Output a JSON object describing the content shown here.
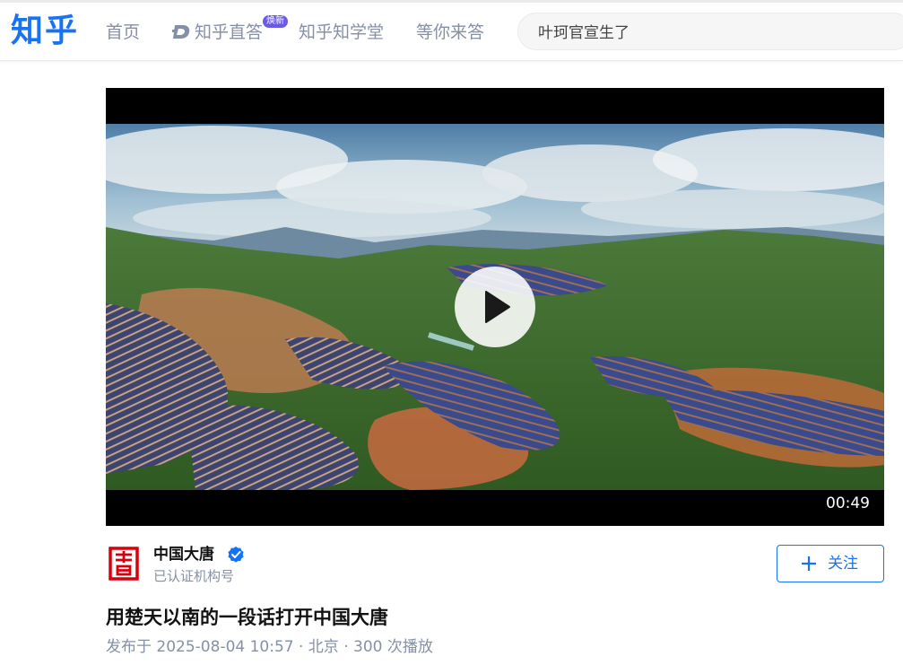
{
  "header": {
    "logo": "知乎",
    "nav": {
      "home": "首页",
      "zhida": "知乎直答",
      "zhida_badge": "焕新",
      "xuetang": "知乎知学堂",
      "wait_answer": "等你来答"
    },
    "search": {
      "placeholder": "叶珂官宣生了"
    }
  },
  "video": {
    "duration": "00:49",
    "play_icon": "play-icon"
  },
  "author": {
    "name": "中国大唐",
    "verified_icon": "verified-check-icon",
    "subtitle": "已认证机构号",
    "avatar_icon": "datang-logo",
    "follow_label": "关注"
  },
  "post": {
    "title": "用楚天以南的一段话打开中国大唐",
    "meta": "发布于 2025-08-04 10:57 · 北京 · 300 次播放"
  },
  "colors": {
    "brand": "#1772f6",
    "muted": "#8590a6",
    "badge": "#6b5ae6",
    "avatar_red": "#d7000f"
  }
}
